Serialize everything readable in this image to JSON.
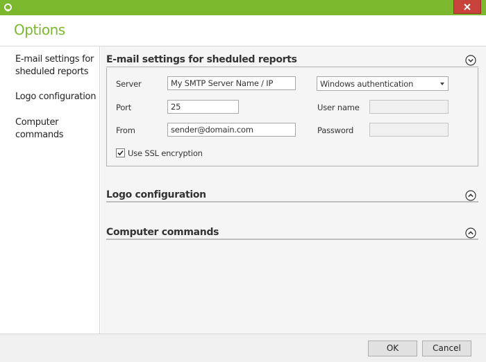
{
  "window": {
    "title": "Options",
    "accent_color": "#7bb82e",
    "close_color": "#c8413a"
  },
  "sidebar": {
    "items": [
      {
        "label_lines": [
          "E-mail settings for",
          "sheduled reports"
        ]
      },
      {
        "label_lines": [
          "Logo configuration"
        ]
      },
      {
        "label_lines": [
          "Computer",
          "commands"
        ]
      }
    ]
  },
  "sections": {
    "email": {
      "title": "E-mail settings for sheduled reports",
      "state": "expanded",
      "server_label": "Server",
      "server_value": "My SMTP Server Name / IP",
      "auth_value": "Windows authentication",
      "port_label": "Port",
      "port_value": "25",
      "username_label": "User name",
      "username_value": "",
      "from_label": "From",
      "from_value": "sender@domain.com",
      "password_label": "Password",
      "password_value": "",
      "ssl_label": "Use SSL encryption",
      "ssl_checked": true
    },
    "logo": {
      "title": "Logo configuration",
      "state": "collapsed"
    },
    "commands": {
      "title": "Computer commands",
      "state": "collapsed"
    }
  },
  "footer": {
    "ok_label": "OK",
    "cancel_label": "Cancel"
  }
}
